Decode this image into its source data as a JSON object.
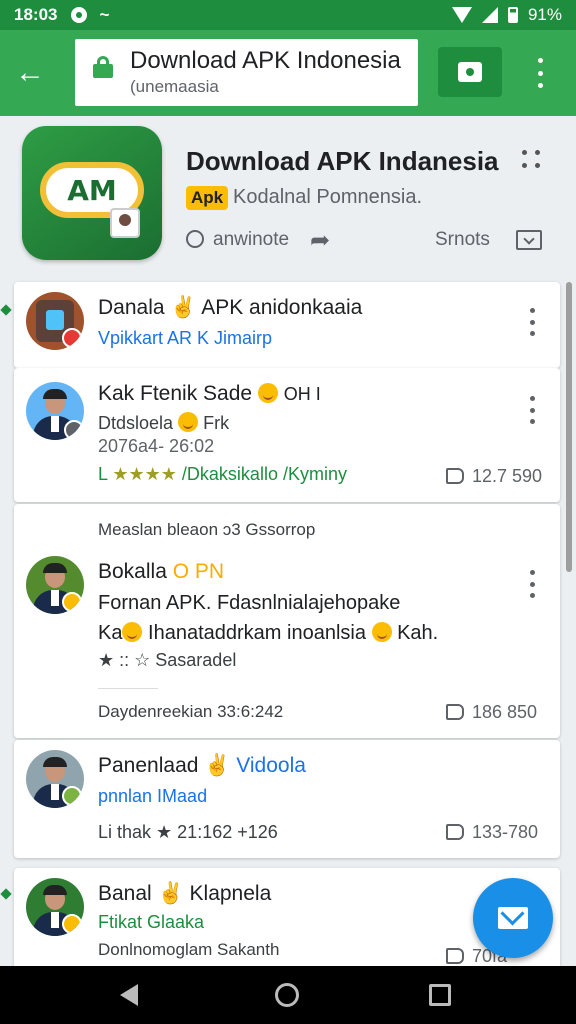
{
  "status_bar": {
    "time": "18:03",
    "wave": "~",
    "battery_text": "91%"
  },
  "app_bar": {
    "url_title": "Download APK Indonesia",
    "url_subtitle": "(unemaasia"
  },
  "app_header": {
    "title": "Download APK Indanesia",
    "badge": "Apk",
    "developer": "Kodalnal Pomnensia.",
    "action_comment": "anwinote",
    "action_right": "Srnots",
    "icon_text": "AM",
    "colors": {
      "primary": "#34a853",
      "dark": "#1e8e3e",
      "badge": "#fbbc04",
      "link": "#1a73e8"
    }
  },
  "feed": {
    "cards": [
      {
        "name": "Danala ✌ APK anidonkaaia",
        "sub": "Vpikkart AR K Jimairp"
      },
      {
        "name": "Kak Ftenik Sade",
        "name_suffix": "OH I",
        "line2": "Dtdsloela",
        "line2_suffix": "Frk",
        "date": "2076a4- 26:02",
        "rating_prefix": "L",
        "rating_stars": "★★★★",
        "rating_text": "/Dkaksikallo /Kyminy",
        "likes": "12.7 590"
      },
      {
        "meta": "Measlan bleaon ↄ3 Gssorrop"
      },
      {
        "name": "Bokalla",
        "name_tag": "O PN",
        "line1": "Fornan  APK. Fdasnlnialajehopake",
        "line2_a": "Ka",
        "line2_b": "Ihanataddrkam inoanlsia",
        "line2_c": "Kah.",
        "rating": "★ ::  ☆ Sasaradel",
        "footer": "Daydenreekian   33:6:242",
        "likes": "186 850"
      },
      {
        "name": "Panenlaad",
        "name_tag": "✌ Vidoola",
        "sub": "pnnlan IMaad",
        "rating": "Li thak ★ 21:162 +126",
        "likes": "133-780"
      },
      {
        "name": "Banal ✌ Klapnela",
        "sub": "Ftikat Glaaka",
        "footer": "Donlnomoglam  Sakanth",
        "likes": "70fa"
      }
    ]
  }
}
